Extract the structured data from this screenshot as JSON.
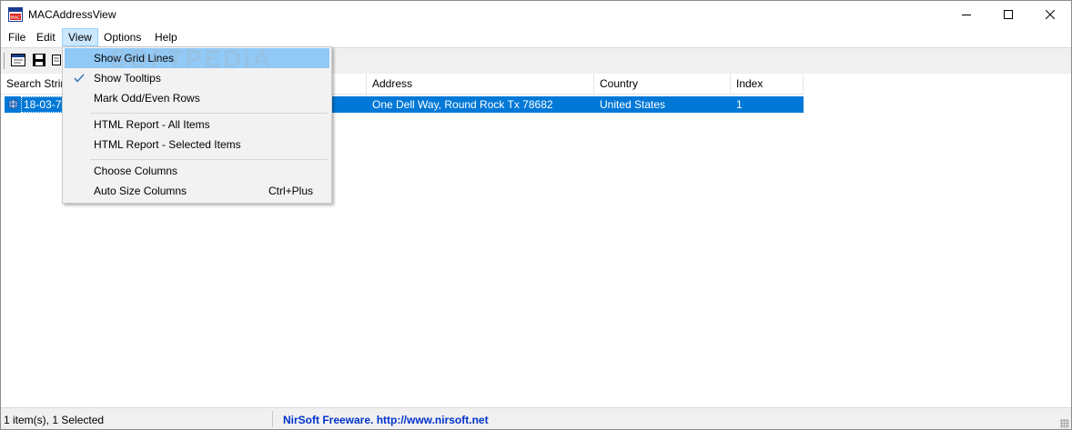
{
  "window": {
    "title": "MACAddressView",
    "app_icon_text": "MAC"
  },
  "menubar": {
    "items": [
      "File",
      "Edit",
      "View",
      "Options",
      "Help"
    ],
    "active": "View"
  },
  "columns": [
    "Search String",
    "",
    "Address",
    "Country",
    "Index"
  ],
  "rows": [
    {
      "search_string": "18-03-73",
      "address": "One Dell Way, Round Rock  Tx  78682",
      "country": "United States",
      "index": "1"
    }
  ],
  "view_menu": {
    "items": [
      {
        "label": "Show Grid Lines",
        "checked": false
      },
      {
        "label": "Show Tooltips",
        "checked": true
      },
      {
        "label": "Mark Odd/Even Rows",
        "checked": false
      },
      {
        "label": "HTML Report - All Items",
        "checked": false
      },
      {
        "label": "HTML Report - Selected Items",
        "checked": false
      },
      {
        "label": "Choose Columns",
        "checked": false
      },
      {
        "label": "Auto Size Columns",
        "shortcut": "Ctrl+Plus",
        "checked": false
      }
    ]
  },
  "statusbar": {
    "items_text": "1 item(s), 1 Selected",
    "freeware_text": "NirSoft Freeware.  http://www.nirsoft.net"
  },
  "watermark": "SOFTPEDIA",
  "colors": {
    "selection": "#0078d7",
    "menu_hover": "#91c9f7",
    "link": "#0033cc"
  }
}
